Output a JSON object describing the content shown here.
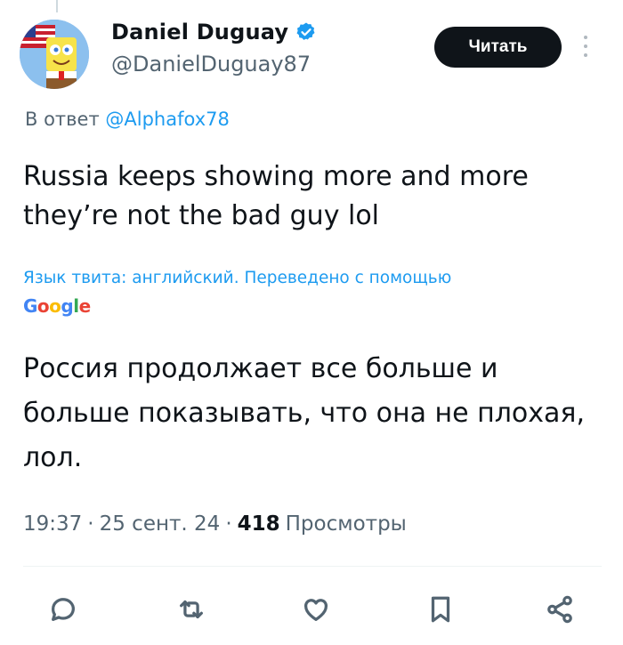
{
  "author": {
    "display_name": "Daniel Duguay",
    "handle": "@DanielDuguay87",
    "verified": true
  },
  "follow_button": {
    "label": "Читать"
  },
  "reply_context": {
    "prefix": "В ответ",
    "mention": "@Alphafox78"
  },
  "tweet": {
    "text": "Russia keeps showing more and more they’re not the bad guy lol",
    "translation_note": "Язык твита: английский. Переведено с помощью",
    "translation_provider": "Google",
    "translated_text": "Россия продолжает все больше и больше показывать, что она не плохая, лол."
  },
  "meta": {
    "time": "19:37",
    "separator": "·",
    "date": "25 сент. 24",
    "views_count": "418",
    "views_label": "Просмотры"
  },
  "actions": {
    "icons": [
      "reply-icon",
      "retweet-icon",
      "like-icon",
      "bookmark-icon",
      "share-icon"
    ]
  },
  "colors": {
    "link": "#1d9bf0",
    "text": "#0f1419",
    "muted": "#536471",
    "button_bg": "#0f1419"
  }
}
